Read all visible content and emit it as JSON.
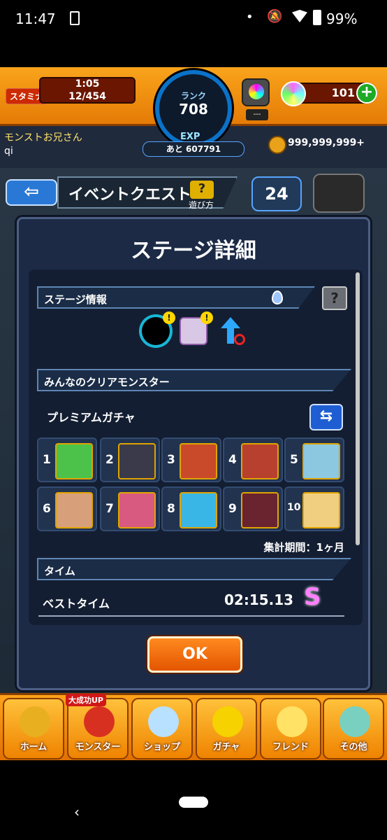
{
  "status_bar": {
    "time": "11:47",
    "battery": "99%",
    "dot": "•",
    "bell": "🔕"
  },
  "top": {
    "stamina_label": "スタミナ",
    "stamina_timer": "1:05",
    "stamina_count": "12/454",
    "rank_label": "ランク",
    "rank_value": "708",
    "exp_label": "EXP",
    "exp_remaining": "あと 607791",
    "gem_box_label": "---",
    "orb_count": "101",
    "plus": "+"
  },
  "user": {
    "name": "モンストお兄さん",
    "id": "qi",
    "coins": "999,999,999+"
  },
  "header": {
    "back_icon": "⇦",
    "title": "イベントクエスト",
    "help_icon": "?",
    "help_label": "遊び方",
    "timer_badge": "24"
  },
  "modal": {
    "title": "ステージ詳細",
    "stage_info_header": "ステージ情報",
    "info_icon": "?",
    "warn": "!",
    "clear_monster_header": "みんなのクリアモンスター",
    "gacha_label": "プレミアムガチャ",
    "swap_icon": "⇆",
    "ranking": [
      {
        "rank": "1",
        "color": "#4cc24a"
      },
      {
        "rank": "2",
        "color": "#3a3a4a"
      },
      {
        "rank": "3",
        "color": "#c84a2a"
      },
      {
        "rank": "4",
        "color": "#b8402e"
      },
      {
        "rank": "5",
        "color": "#8cc8e0"
      },
      {
        "rank": "6",
        "color": "#d8a07a"
      },
      {
        "rank": "7",
        "color": "#d85a80"
      },
      {
        "rank": "8",
        "color": "#3ab6e6"
      },
      {
        "rank": "9",
        "color": "#6a2430"
      },
      {
        "rank": "10",
        "color": "#f0d080"
      }
    ],
    "period": "集計期間：1ヶ月",
    "time_header": "タイム",
    "best_time_label": "ベストタイム",
    "best_time_value": "02:15.13",
    "best_rank": "S",
    "ok_label": "OK"
  },
  "bottom_nav": {
    "badge": "大成功UP",
    "items": [
      {
        "label": "ホーム",
        "color": "#e8b020"
      },
      {
        "label": "モンスター",
        "color": "#d83020"
      },
      {
        "label": "ショップ",
        "color": "#b8e0ff"
      },
      {
        "label": "ガチャ",
        "color": "#f6d200"
      },
      {
        "label": "フレンド",
        "color": "#ffe266"
      },
      {
        "label": "その他",
        "color": "#7ad0c0"
      }
    ]
  },
  "system_nav": {
    "back": "‹"
  }
}
